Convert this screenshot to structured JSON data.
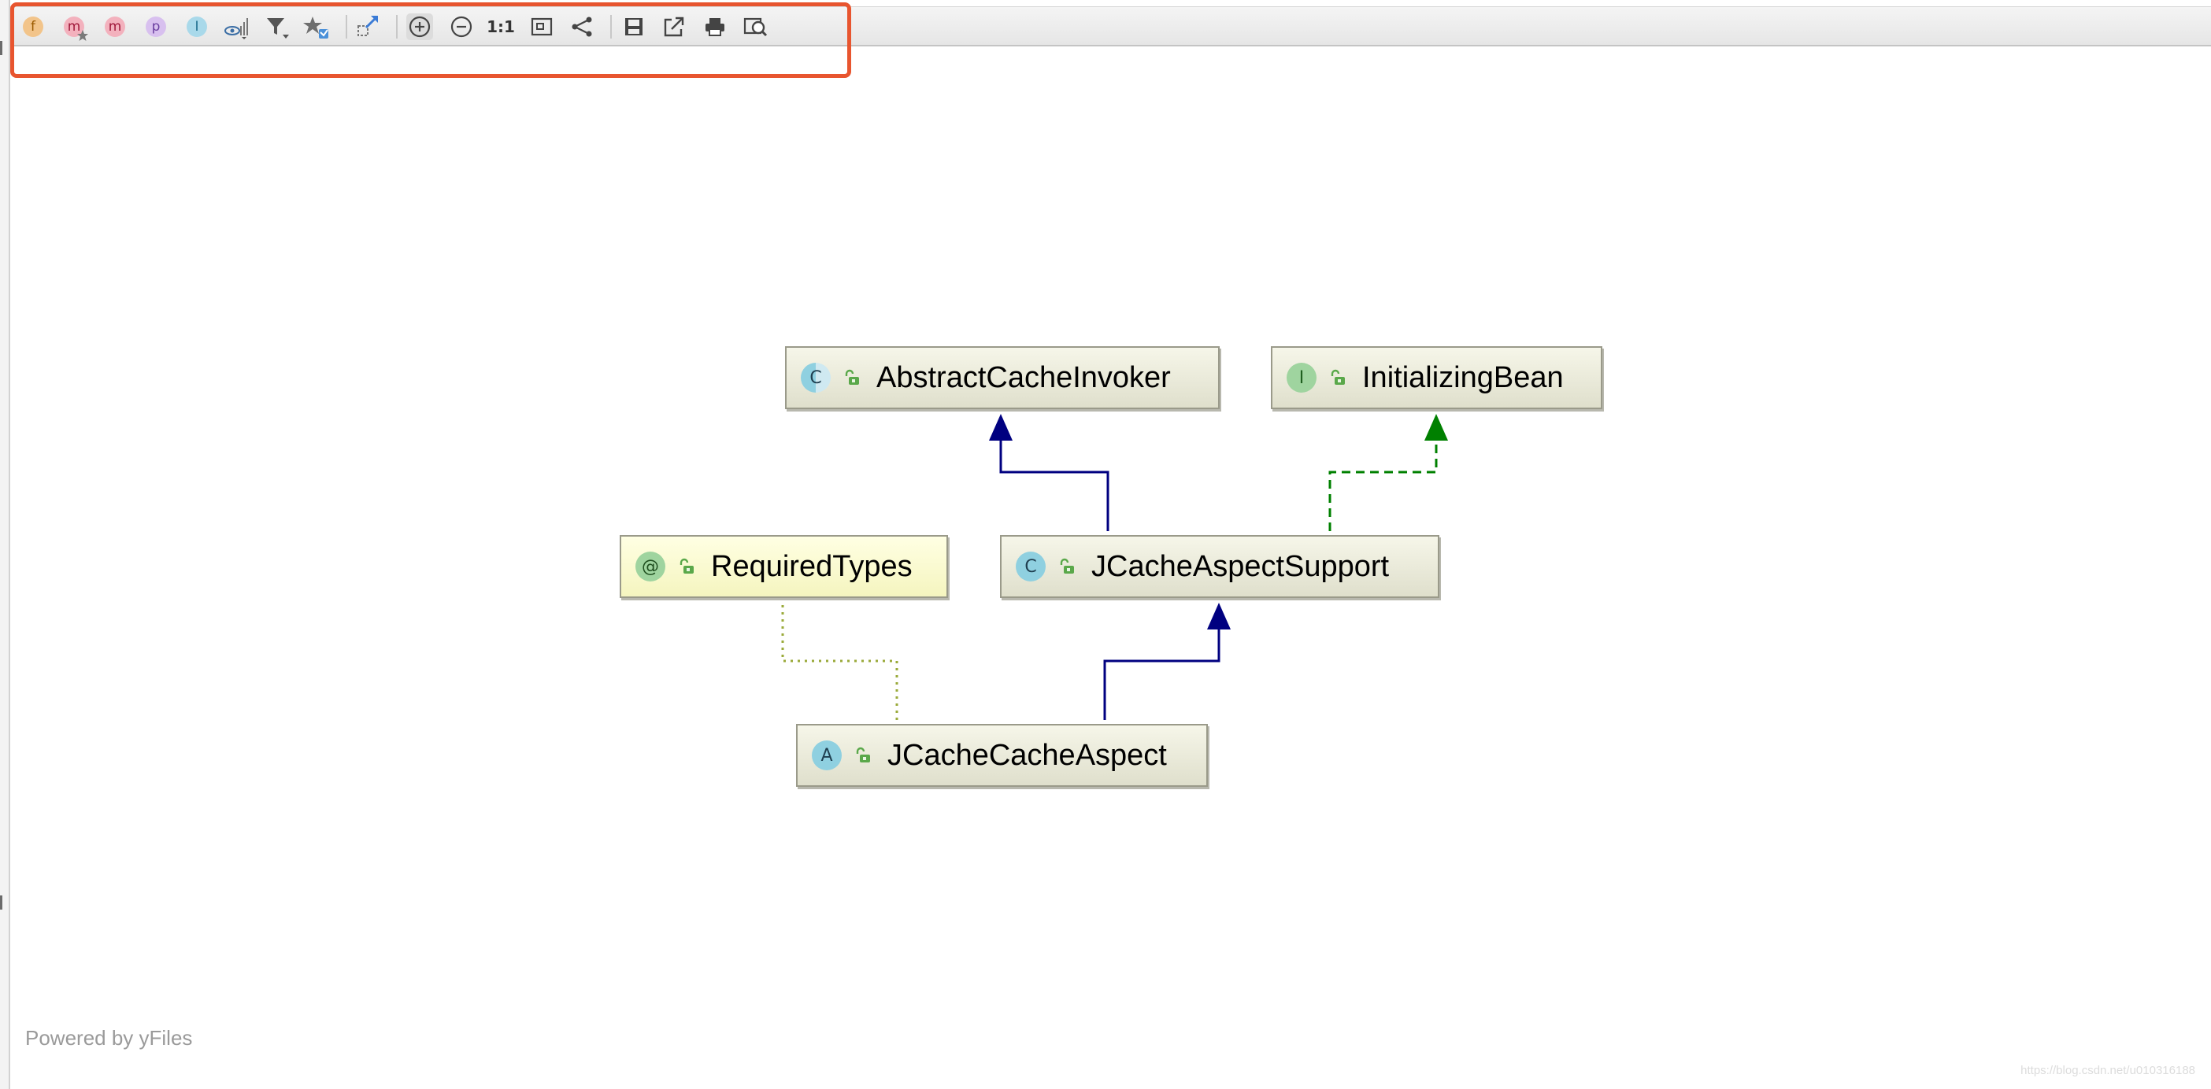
{
  "toolbar": {
    "buttons": [
      {
        "name": "fields-filter-button",
        "glyph": "f",
        "bg": "#f2c48a",
        "fg": "#9a5a00"
      },
      {
        "name": "constructors-filter-button",
        "glyph": "m",
        "bg": "#f3b1bd",
        "fg": "#a0183a"
      },
      {
        "name": "methods-filter-button",
        "glyph": "m",
        "bg": "#f3b1bd",
        "fg": "#a0183a"
      },
      {
        "name": "properties-filter-button",
        "glyph": "p",
        "bg": "#d8c0ef",
        "fg": "#6b3fa0"
      },
      {
        "name": "inner-classes-filter-button",
        "glyph": "I",
        "bg": "#a9d9ea",
        "fg": "#1f6f8f"
      }
    ],
    "zoom_actual_label": "1:1"
  },
  "colors": {
    "highlight": "#e8552f",
    "extends_edge": "#000080",
    "implements_edge": "#008000",
    "annotation_edge": "#9aaa3a",
    "class_badge": "#8fd0e0",
    "interface_badge": "#9fd49f",
    "annotation_badge": "#9fd49f",
    "access_icon": "#5aa84a"
  },
  "nodes": {
    "abstract_cache_invoker": {
      "kind": "C",
      "label": "AbstractCacheInvoker"
    },
    "initializing_bean": {
      "kind": "I",
      "label": "InitializingBean"
    },
    "required_types": {
      "kind": "@",
      "label": "RequiredTypes"
    },
    "jcache_aspect_support": {
      "kind": "C",
      "label": "JCacheAspectSupport"
    },
    "jcache_cache_aspect": {
      "kind": "A",
      "label": "JCacheCacheAspect"
    }
  },
  "footer": {
    "powered_by": "Powered by yFiles",
    "watermark": "https://blog.csdn.net/u010316188"
  }
}
